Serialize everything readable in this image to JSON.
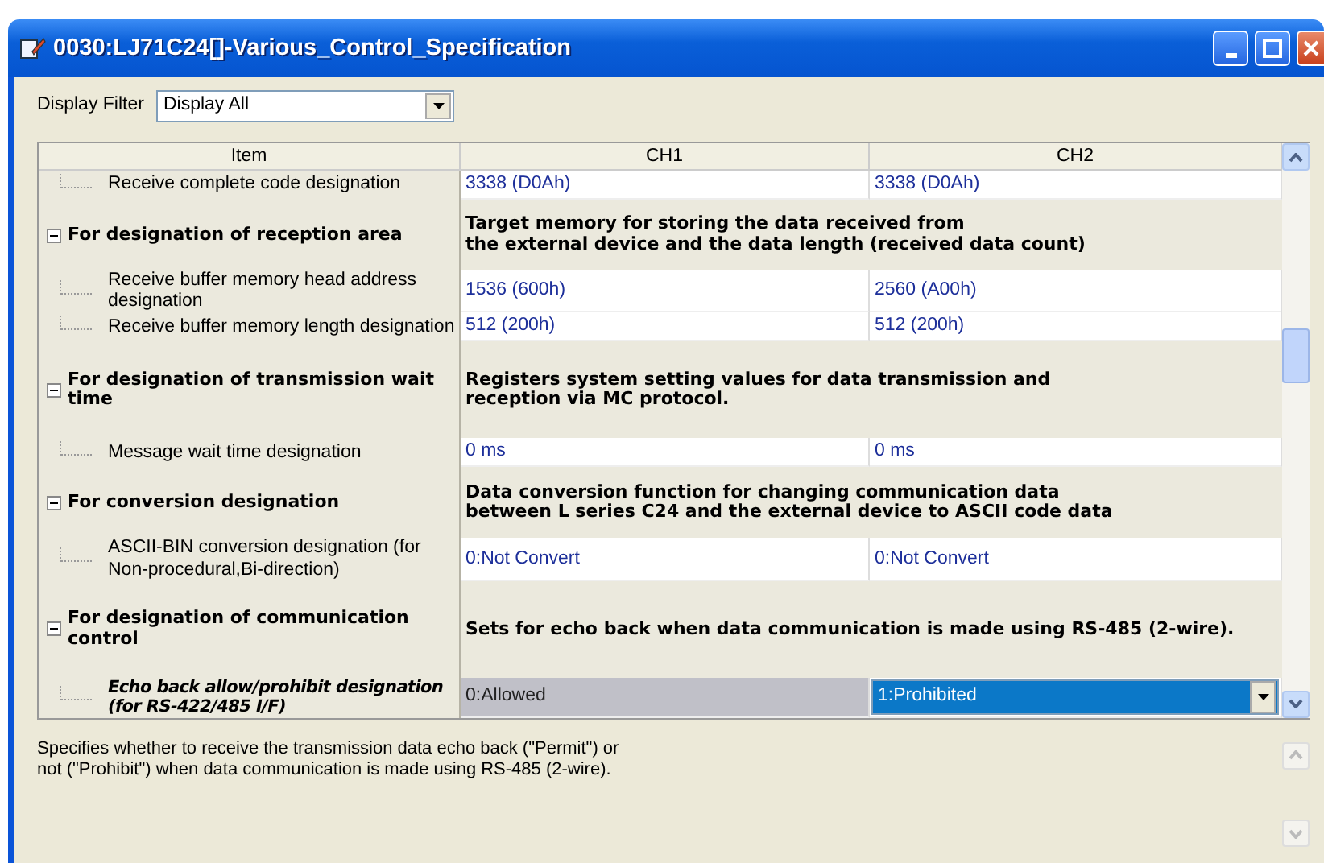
{
  "window": {
    "title": "0030:LJ71C24[]-Various_Control_Specification"
  },
  "display_filter": {
    "label": "Display Filter",
    "value": "Display All"
  },
  "table": {
    "columns": [
      "Item",
      "CH1",
      "CH2"
    ],
    "rows": [
      {
        "kind": "setting",
        "label": "Receive complete code designation",
        "ch1": "3338 (D0Ah)",
        "ch2": "3338 (D0Ah)",
        "selected": false
      },
      {
        "kind": "group",
        "label": "For designation of reception area",
        "description": "Target memory for storing the data received from\nthe external device and the data length (received data count)",
        "expanded": true
      },
      {
        "kind": "setting",
        "label": "Receive buffer memory head address designation",
        "ch1": "1536 (600h)",
        "ch2": "2560 (A00h)",
        "selected": false
      },
      {
        "kind": "setting",
        "label": "Receive buffer memory length designation",
        "ch1": "512 (200h)",
        "ch2": "512 (200h)",
        "selected": false
      },
      {
        "kind": "group",
        "label": "For designation of transmission wait time",
        "description": "Registers system setting values for data transmission and\nreception via MC protocol.",
        "expanded": true
      },
      {
        "kind": "setting",
        "label": "Message wait time designation",
        "ch1": "0 ms",
        "ch2": "0 ms",
        "selected": false
      },
      {
        "kind": "group",
        "label": "For conversion designation",
        "description": "Data conversion function for changing communication data\nbetween L series C24 and the external device to ASCII code data",
        "expanded": true
      },
      {
        "kind": "setting",
        "label": "ASCII-BIN conversion designation (for Non-procedural,Bi-direction)",
        "ch1": "0:Not Convert",
        "ch2": "0:Not Convert",
        "selected": false
      },
      {
        "kind": "group",
        "label": "For designation of communication control",
        "description": "Sets for echo back when data communication is made using RS-485 (2-wire).",
        "expanded": true
      },
      {
        "kind": "setting",
        "label": "Echo back allow/prohibit designation (for RS-422/485 I/F)",
        "ch1": "0:Allowed",
        "ch2": "1:Prohibited",
        "selected": true
      }
    ]
  },
  "help_text": "Specifies whether to receive the transmission data echo back (\"Permit\") or\nnot (\"Prohibit\") when data communication is made using RS-485 (2-wire)."
}
